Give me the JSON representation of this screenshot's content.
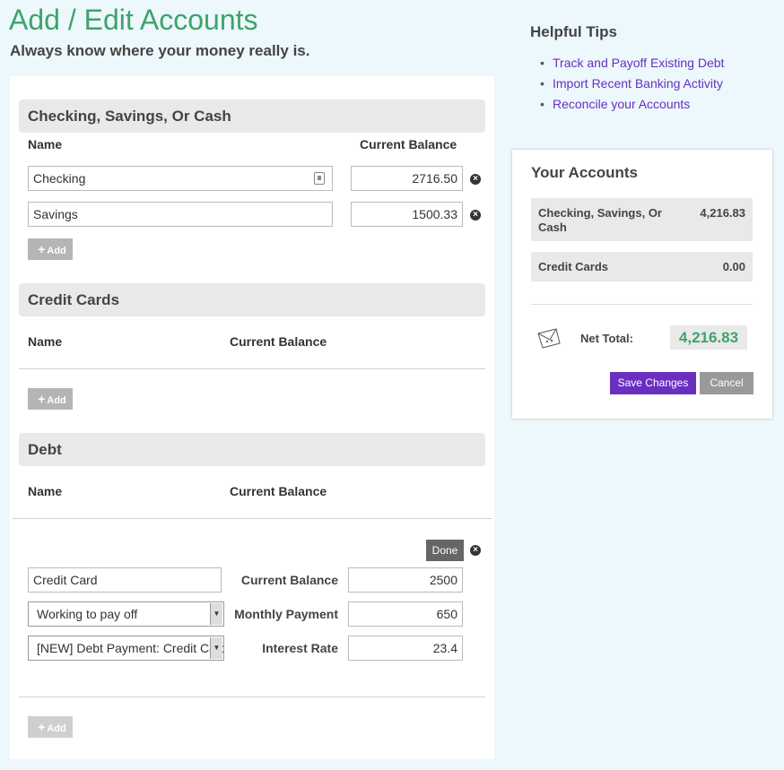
{
  "page": {
    "title": "Add / Edit Accounts",
    "tagline": "Always know where your money really is."
  },
  "sections": {
    "checking": {
      "title": "Checking, Savings, Or Cash",
      "col_name": "Name",
      "col_balance": "Current Balance",
      "rows": [
        {
          "name": "Checking",
          "balance": "2716.50"
        },
        {
          "name": "Savings",
          "balance": "1500.33"
        }
      ],
      "add_label": "Add"
    },
    "credit": {
      "title": "Credit Cards",
      "col_name": "Name",
      "col_balance": "Current Balance",
      "add_label": "Add"
    },
    "debt": {
      "title": "Debt",
      "col_name": "Name",
      "col_balance": "Current Balance",
      "done_label": "Done",
      "entry": {
        "name": "Credit Card",
        "status": "Working to pay off",
        "payment_category": "[NEW] Debt Payment: Credit Card",
        "current_balance_label": "Current Balance",
        "current_balance": "2500",
        "monthly_payment_label": "Monthly Payment",
        "monthly_payment": "650",
        "interest_rate_label": "Interest Rate",
        "interest_rate": "23.4"
      },
      "add_label": "Add"
    }
  },
  "tips": {
    "title": "Helpful Tips",
    "items": [
      "Track and Payoff Existing Debt",
      "Import Recent Banking Activity",
      "Reconcile your Accounts"
    ]
  },
  "accounts": {
    "title": "Your Accounts",
    "rows": [
      {
        "name": "Checking, Savings, Or Cash",
        "value": "4,216.83"
      },
      {
        "name": "Credit Cards",
        "value": "0.00"
      }
    ],
    "net_label": "Net Total:",
    "net_value": "4,216.83",
    "save_label": "Save Changes",
    "cancel_label": "Cancel"
  },
  "colors": {
    "brand_green": "#3fa36b",
    "accent_purple": "#6a2fc0",
    "page_bg": "#ecf8fc"
  },
  "icons": {
    "remove": "remove-circle-icon",
    "contact": "contact-card-icon",
    "plus": "plus-icon",
    "dropdown": "chevron-down-icon",
    "net": "money-envelope-icon"
  }
}
